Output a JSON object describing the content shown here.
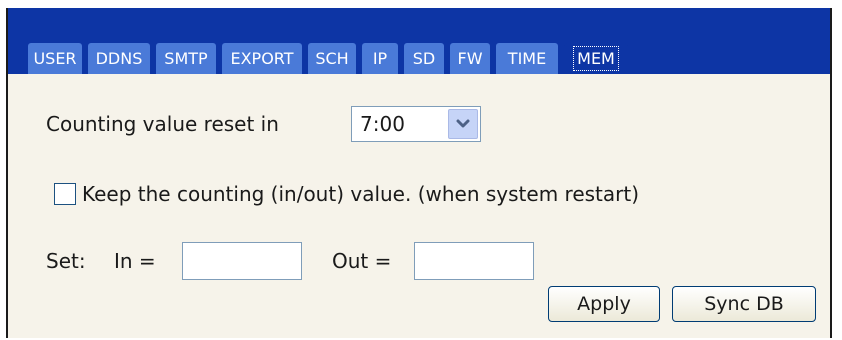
{
  "tabs": [
    {
      "label": "USER",
      "active": false
    },
    {
      "label": "DDNS",
      "active": false
    },
    {
      "label": "SMTP",
      "active": false
    },
    {
      "label": "EXPORT",
      "active": false
    },
    {
      "label": "SCH",
      "active": false
    },
    {
      "label": "IP",
      "active": false
    },
    {
      "label": "SD",
      "active": false
    },
    {
      "label": "FW",
      "active": false
    },
    {
      "label": "TIME",
      "active": false
    },
    {
      "label": "MEM",
      "active": true
    }
  ],
  "reset": {
    "label": "Counting value reset in",
    "selected": "7:00"
  },
  "keep": {
    "label": "Keep the counting (in/out) value. (when system restart)",
    "checked": false
  },
  "set": {
    "label": "Set:",
    "in_label": "In =",
    "out_label": "Out =",
    "in_value": "",
    "out_value": ""
  },
  "buttons": {
    "apply": "Apply",
    "sync": "Sync DB"
  },
  "colors": {
    "tabbar": "#0d35a5",
    "tab": "#4a7ad8",
    "panel": "#f6f3ea"
  }
}
